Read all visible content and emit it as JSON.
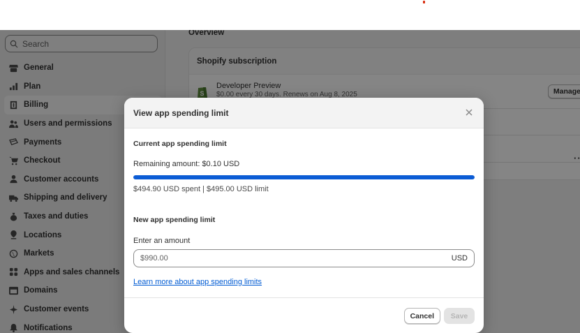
{
  "sidebar": {
    "search_placeholder": "Search",
    "items": [
      {
        "label": "General",
        "icon": "store-icon"
      },
      {
        "label": "Plan",
        "icon": "chart-icon"
      },
      {
        "label": "Billing",
        "icon": "receipt-icon"
      },
      {
        "label": "Users and permissions",
        "icon": "users-icon"
      },
      {
        "label": "Payments",
        "icon": "payments-icon"
      },
      {
        "label": "Checkout",
        "icon": "cart-icon"
      },
      {
        "label": "Customer accounts",
        "icon": "person-icon"
      },
      {
        "label": "Shipping and delivery",
        "icon": "truck-icon"
      },
      {
        "label": "Taxes and duties",
        "icon": "tax-icon"
      },
      {
        "label": "Locations",
        "icon": "location-icon"
      },
      {
        "label": "Markets",
        "icon": "globe-icon"
      },
      {
        "label": "Apps and sales channels",
        "icon": "apps-icon"
      },
      {
        "label": "Domains",
        "icon": "domain-icon"
      },
      {
        "label": "Customer events",
        "icon": "sparkle-icon"
      },
      {
        "label": "Notifications",
        "icon": "bell-icon"
      }
    ],
    "active_item": "Billing"
  },
  "main": {
    "overview_title": "Overview",
    "subscription_title": "Shopify subscription",
    "plan_name": "Developer Preview",
    "plan_detail": "$0.00 every 30 days. Renews on Aug 8, 2025",
    "manage_label": "Manage",
    "more_label": "···"
  },
  "modal": {
    "title": "View app spending limit",
    "current_title": "Current app spending limit",
    "remaining": "Remaining amount: $0.10 USD",
    "progress_spent_fraction": 0.9998,
    "spent_text": "$494.90 USD spent",
    "limit_text": "$495.00 USD limit",
    "new_title": "New app spending limit",
    "input_label": "Enter an amount",
    "input_value": "$990.00",
    "currency": "USD",
    "learn_more": "Learn more about app spending limits",
    "cancel_label": "Cancel",
    "save_label": "Save"
  },
  "colors": {
    "progress": "#0b5cd5",
    "link": "#005bd3"
  }
}
